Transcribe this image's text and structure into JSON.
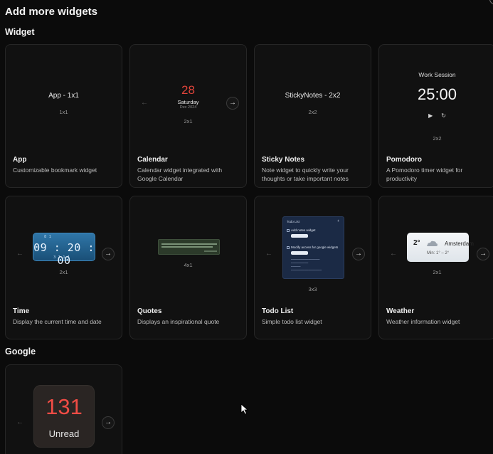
{
  "page": {
    "title": "Add more widgets"
  },
  "sections": {
    "widget": "Widget",
    "google": "Google"
  },
  "cards": {
    "app": {
      "name": "App",
      "desc": "Customizable bookmark widget",
      "size": "1x1",
      "preview_title": "App - 1x1"
    },
    "calendar": {
      "name": "Calendar",
      "desc": "Calendar widget integrated with Google Calendar",
      "size": "2x1",
      "day": "28",
      "weekday": "Saturday",
      "month_year": "Dec 2024"
    },
    "sticky": {
      "name": "Sticky Notes",
      "desc": "Note widget to quickly write your thoughts or take important notes",
      "size": "2x2",
      "preview_title": "StickyNotes - 2x2"
    },
    "pomodoro": {
      "name": "Pomodoro",
      "desc": "A Pomodoro timer widget for productivity",
      "size": "2x2",
      "label": "Work Session",
      "time": "25:00"
    },
    "time": {
      "name": "Time",
      "desc": "Display the current time and date",
      "size": "2x1",
      "digits": "09 : 20 : 00",
      "top_row": "8    1",
      "bottom_row": "3 1    1 1"
    },
    "quotes": {
      "name": "Quotes",
      "desc": "Displays an inspirational quote",
      "size": "4x1"
    },
    "todo": {
      "name": "Todo List",
      "desc": "Simple todo list widget",
      "size": "3x3",
      "preview_title": "Todo List",
      "add": "+",
      "item1": "Add notes widget",
      "item2": "Modify access for google widgets"
    },
    "weather": {
      "name": "Weather",
      "desc": "Weather information widget",
      "size": "2x1",
      "temp": "2°",
      "city": "Amsterdam",
      "minmax": "Min: 1° – 2°"
    },
    "gmail": {
      "count": "131",
      "label": "Unread"
    }
  },
  "icons": {
    "prev": "‹",
    "next": "›",
    "play": "▶",
    "reset": "↻"
  },
  "colors": {
    "background": "#0b0b0b",
    "card": "#111111",
    "calendar_day": "#e0443a",
    "gmail_count": "#ef4c45",
    "clock_blue": "#2f76a8",
    "todo_panel": "#1b2a45"
  }
}
